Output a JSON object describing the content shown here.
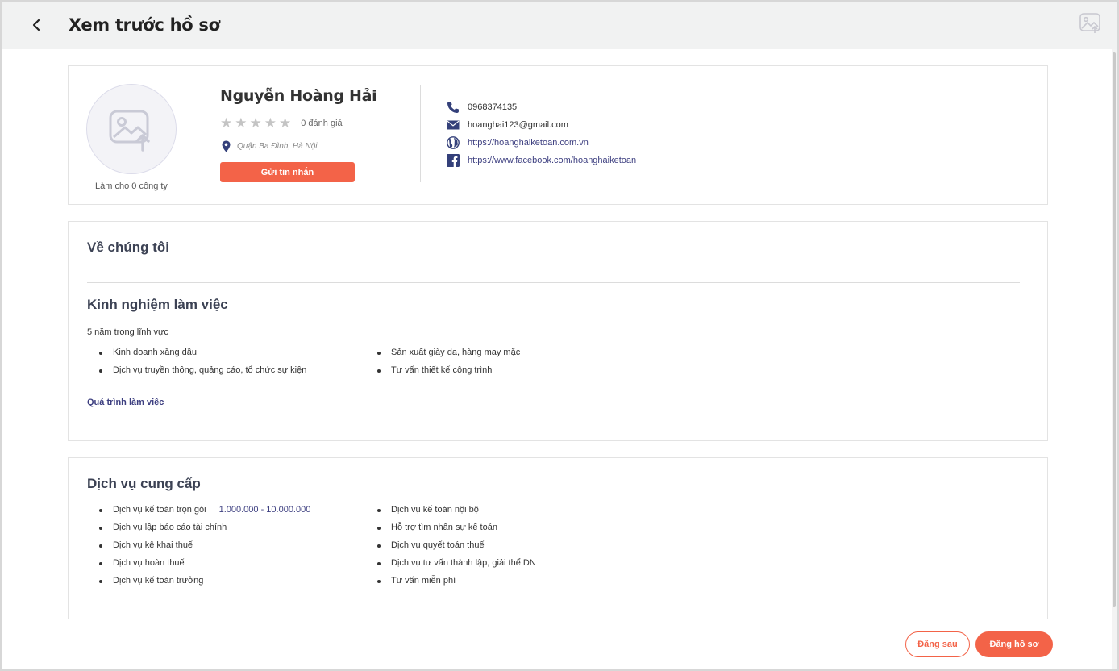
{
  "header": {
    "back_icon": "chevron-left-icon",
    "title": "Xem trước hồ sơ",
    "corner_icon": "image-upload-icon"
  },
  "profile": {
    "avatar_icon": "image-upload-icon",
    "work_for": "Làm cho 0 công ty",
    "name": "Nguyễn Hoàng Hải",
    "rating": 0,
    "max_rating": 5,
    "rating_label": "0 đánh giá",
    "location": "Quận Ba Đình, Hà Nội",
    "message_button": "Gửi tin nhắn",
    "contacts": {
      "phone": "0968374135",
      "email": "hoanghai123@gmail.com",
      "website": "https://hoanghaiketoan.com.vn",
      "facebook": "https://www.facebook.com/hoanghaiketoan"
    }
  },
  "about": {
    "title": "Về chúng tôi",
    "experience_title": "Kinh nghiệm làm việc",
    "years": "5 năm trong lĩnh vực",
    "fields_left": [
      "Kinh doanh xăng dầu",
      "Dịch vụ truyền thông, quảng cáo, tổ chức sự kiện"
    ],
    "fields_right": [
      "Sản xuất giày da, hàng may mặc",
      "Tư vấn thiết kế công trình"
    ],
    "history_link": "Quá trình làm việc"
  },
  "services": {
    "title": "Dịch vụ cung cấp",
    "left": [
      {
        "name": "Dịch vụ kế toán trọn gói",
        "price": "1.000.000 - 10.000.000"
      },
      {
        "name": "Dịch vụ lập báo cáo tài chính"
      },
      {
        "name": "Dịch vụ kê khai thuế"
      },
      {
        "name": "Dịch vụ hoàn thuế"
      },
      {
        "name": "Dịch vụ kế toán trưởng"
      }
    ],
    "right": [
      "Dịch vụ kế toán nội bộ",
      "Hỗ trợ tìm nhân sự kế toán",
      "Dịch vụ quyết toán thuế",
      "Dịch vụ tư vấn thành lập, giải thể DN",
      "Tư vấn miễn phí"
    ]
  },
  "footer": {
    "later_button": "Đăng sau",
    "publish_button": "Đăng hồ sơ"
  },
  "colors": {
    "accent": "#f36348",
    "link": "#3d3f80",
    "icon": "#34407a"
  }
}
